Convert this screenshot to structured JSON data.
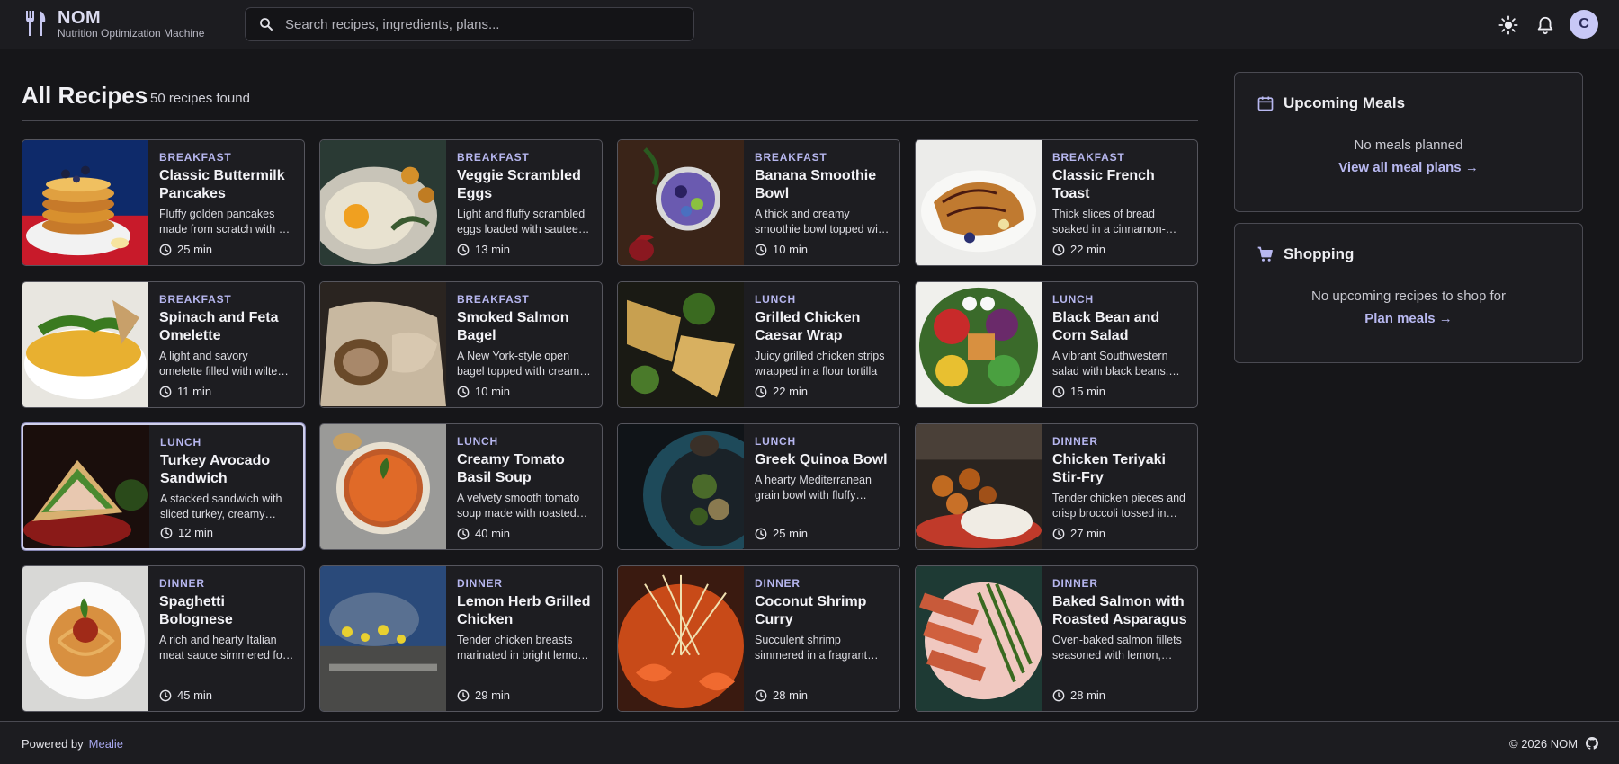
{
  "app": {
    "name": "NOM",
    "subtitle": "Nutrition Optimization Machine",
    "search_placeholder": "Search recipes, ingredients, plans...",
    "avatar_initial": "C"
  },
  "main": {
    "title": "All Recipes",
    "count": "50 recipes found"
  },
  "recipes": [
    {
      "category": "Breakfast",
      "title": "Classic Buttermilk Pancakes",
      "desc": "Fluffy golden pancakes made from scratch with a tangy buttermilk batter",
      "time": "25 min"
    },
    {
      "category": "Breakfast",
      "title": "Veggie Scrambled Eggs",
      "desc": "Light and fluffy scrambled eggs loaded with sauteed vegetables",
      "time": "13 min"
    },
    {
      "category": "Breakfast",
      "title": "Banana Smoothie Bowl",
      "desc": "A thick and creamy smoothie bowl topped with fresh fruit",
      "time": "10 min"
    },
    {
      "category": "Breakfast",
      "title": "Classic French Toast",
      "desc": "Thick slices of bread soaked in a cinnamon-vanilla custard",
      "time": "22 min"
    },
    {
      "category": "Breakfast",
      "title": "Spinach and Feta Omelette",
      "desc": "A light and savory omelette filled with wilted spinach and feta",
      "time": "11 min"
    },
    {
      "category": "Breakfast",
      "title": "Smoked Salmon Bagel",
      "desc": "A New York-style open bagel topped with cream cheese and salmon",
      "time": "10 min"
    },
    {
      "category": "Lunch",
      "title": "Grilled Chicken Caesar Wrap",
      "desc": "Juicy grilled chicken strips wrapped in a flour tortilla",
      "time": "22 min"
    },
    {
      "category": "Lunch",
      "title": "Black Bean and Corn Salad",
      "desc": "A vibrant Southwestern salad with black beans, corn and peppers",
      "time": "15 min"
    },
    {
      "category": "Lunch",
      "title": "Turkey Avocado Sandwich",
      "desc": "A stacked sandwich with sliced turkey, creamy avocado and greens",
      "time": "12 min"
    },
    {
      "category": "Lunch",
      "title": "Creamy Tomato Basil Soup",
      "desc": "A velvety smooth tomato soup made with roasted tomatoes",
      "time": "40 min"
    },
    {
      "category": "Lunch",
      "title": "Greek Quinoa Bowl",
      "desc": "A hearty Mediterranean grain bowl with fluffy quinoa",
      "time": "25 min"
    },
    {
      "category": "Dinner",
      "title": "Chicken Teriyaki Stir-Fry",
      "desc": "Tender chicken pieces and crisp broccoli tossed in teriyaki sauce",
      "time": "27 min"
    },
    {
      "category": "Dinner",
      "title": "Spaghetti Bolognese",
      "desc": "A rich and hearty Italian meat sauce simmered for hours",
      "time": "45 min"
    },
    {
      "category": "Dinner",
      "title": "Lemon Herb Grilled Chicken",
      "desc": "Tender chicken breasts marinated in bright lemon and herbs",
      "time": "29 min"
    },
    {
      "category": "Dinner",
      "title": "Coconut Shrimp Curry",
      "desc": "Succulent shrimp simmered in a fragrant coconut curry sauce",
      "time": "28 min"
    },
    {
      "category": "Dinner",
      "title": "Baked Salmon with Roasted Asparagus",
      "desc": "Oven-baked salmon fillets seasoned with lemon, garlic and dill",
      "time": "28 min"
    }
  ],
  "sidebar": {
    "upcoming": {
      "title": "Upcoming Meals",
      "message": "No meals planned",
      "link": "View all meal plans →"
    },
    "shopping": {
      "title": "Shopping",
      "message": "No upcoming recipes to shop for",
      "link": "Plan meals →"
    }
  },
  "footer": {
    "powered_by": "Powered by",
    "powered_link": "Mealie",
    "copyright": "© 2026 NOM"
  },
  "colors": {
    "accent": "#b8b8f0",
    "background": "#161619",
    "surface": "#1d1d21"
  }
}
